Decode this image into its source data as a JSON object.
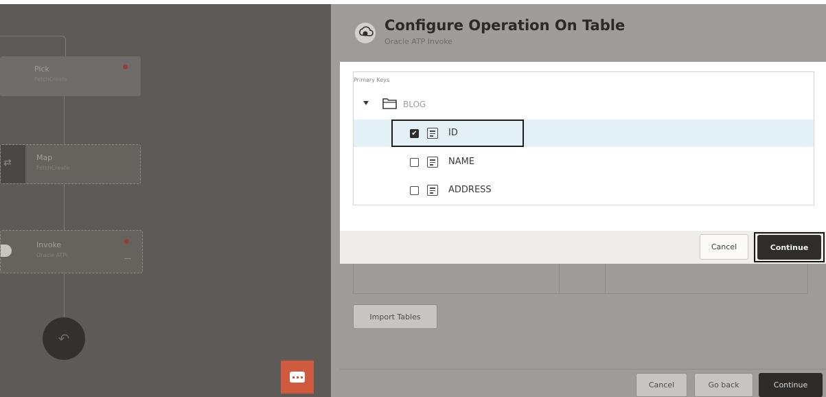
{
  "canvas": {
    "nodes": [
      {
        "title": "Pick",
        "subtitle": "FetchCreate"
      },
      {
        "title": "Map",
        "subtitle": "FetchCreate"
      },
      {
        "title": "Invoke",
        "subtitle": "Oracle ATPi"
      }
    ],
    "chat_icon": "chat-icon",
    "return_icon": "return-icon"
  },
  "panel": {
    "title": "Configure Operation On Table",
    "subtitle": "Oracle ATP Invoke",
    "import_tables_label": "Import Tables",
    "footer": {
      "cancel": "Cancel",
      "go_back": "Go back",
      "continue": "Continue"
    }
  },
  "modal": {
    "section_label": "Primary Keys",
    "table": {
      "name": "BLOG",
      "expanded": true
    },
    "columns": [
      {
        "name": "ID",
        "checked": true
      },
      {
        "name": "NAME",
        "checked": false
      },
      {
        "name": "ADDRESS",
        "checked": false
      }
    ],
    "cancel_label": "Cancel",
    "continue_label": "Continue"
  }
}
